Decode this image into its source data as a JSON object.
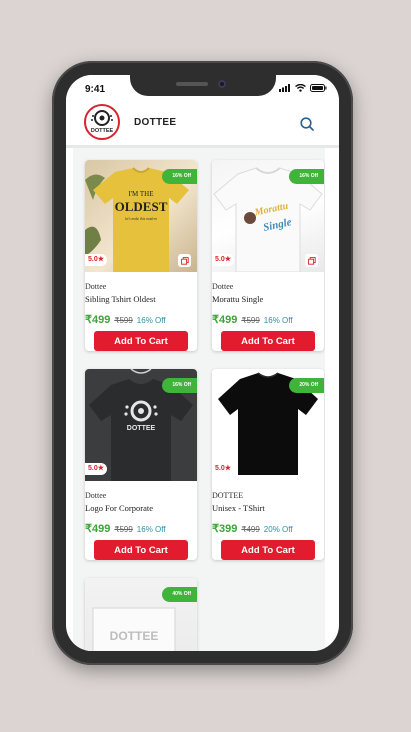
{
  "status_bar": {
    "time": "9:41"
  },
  "header": {
    "brand": "DOTTEE",
    "logo_text": "DOTTEE"
  },
  "products": [
    {
      "image_text_1": "I'M THE",
      "image_text_2": "OLDEST",
      "image_text_3": "let's make this modern",
      "discount_badge": "16% Off",
      "rating": "5.0★",
      "vendor": "Dottee",
      "name": "Sibling Tshirt Oldest",
      "price": "₹499",
      "mrp": "₹599",
      "discount": "16% Off",
      "button": "Add To Cart"
    },
    {
      "image_text_1": "Morattu",
      "image_text_2": "Single",
      "discount_badge": "16% Off",
      "rating": "5.0★",
      "vendor": "Dottee",
      "name": "Morattu Single",
      "price": "₹499",
      "mrp": "₹599",
      "discount": "16% Off",
      "button": "Add To Cart"
    },
    {
      "image_text_1": "DOTTEE",
      "discount_badge": "16% Off",
      "rating": "5.0★",
      "vendor": "Dottee",
      "name": "Logo For Corporate",
      "price": "₹499",
      "mrp": "₹599",
      "discount": "16% Off",
      "button": "Add To Cart"
    },
    {
      "discount_badge": "20% Off",
      "rating": "5.0★",
      "vendor": "DOTTEE",
      "name": "Unisex - TShirt",
      "price": "₹399",
      "mrp": "₹499",
      "discount": "20% Off",
      "button": "Add To Cart"
    },
    {
      "image_text_1": "DOTTEE",
      "discount_badge": "40% Off"
    }
  ],
  "colors": {
    "accent_red": "#e31b2f",
    "price_green": "#3fa33a",
    "badge_green": "#3fb33a"
  }
}
